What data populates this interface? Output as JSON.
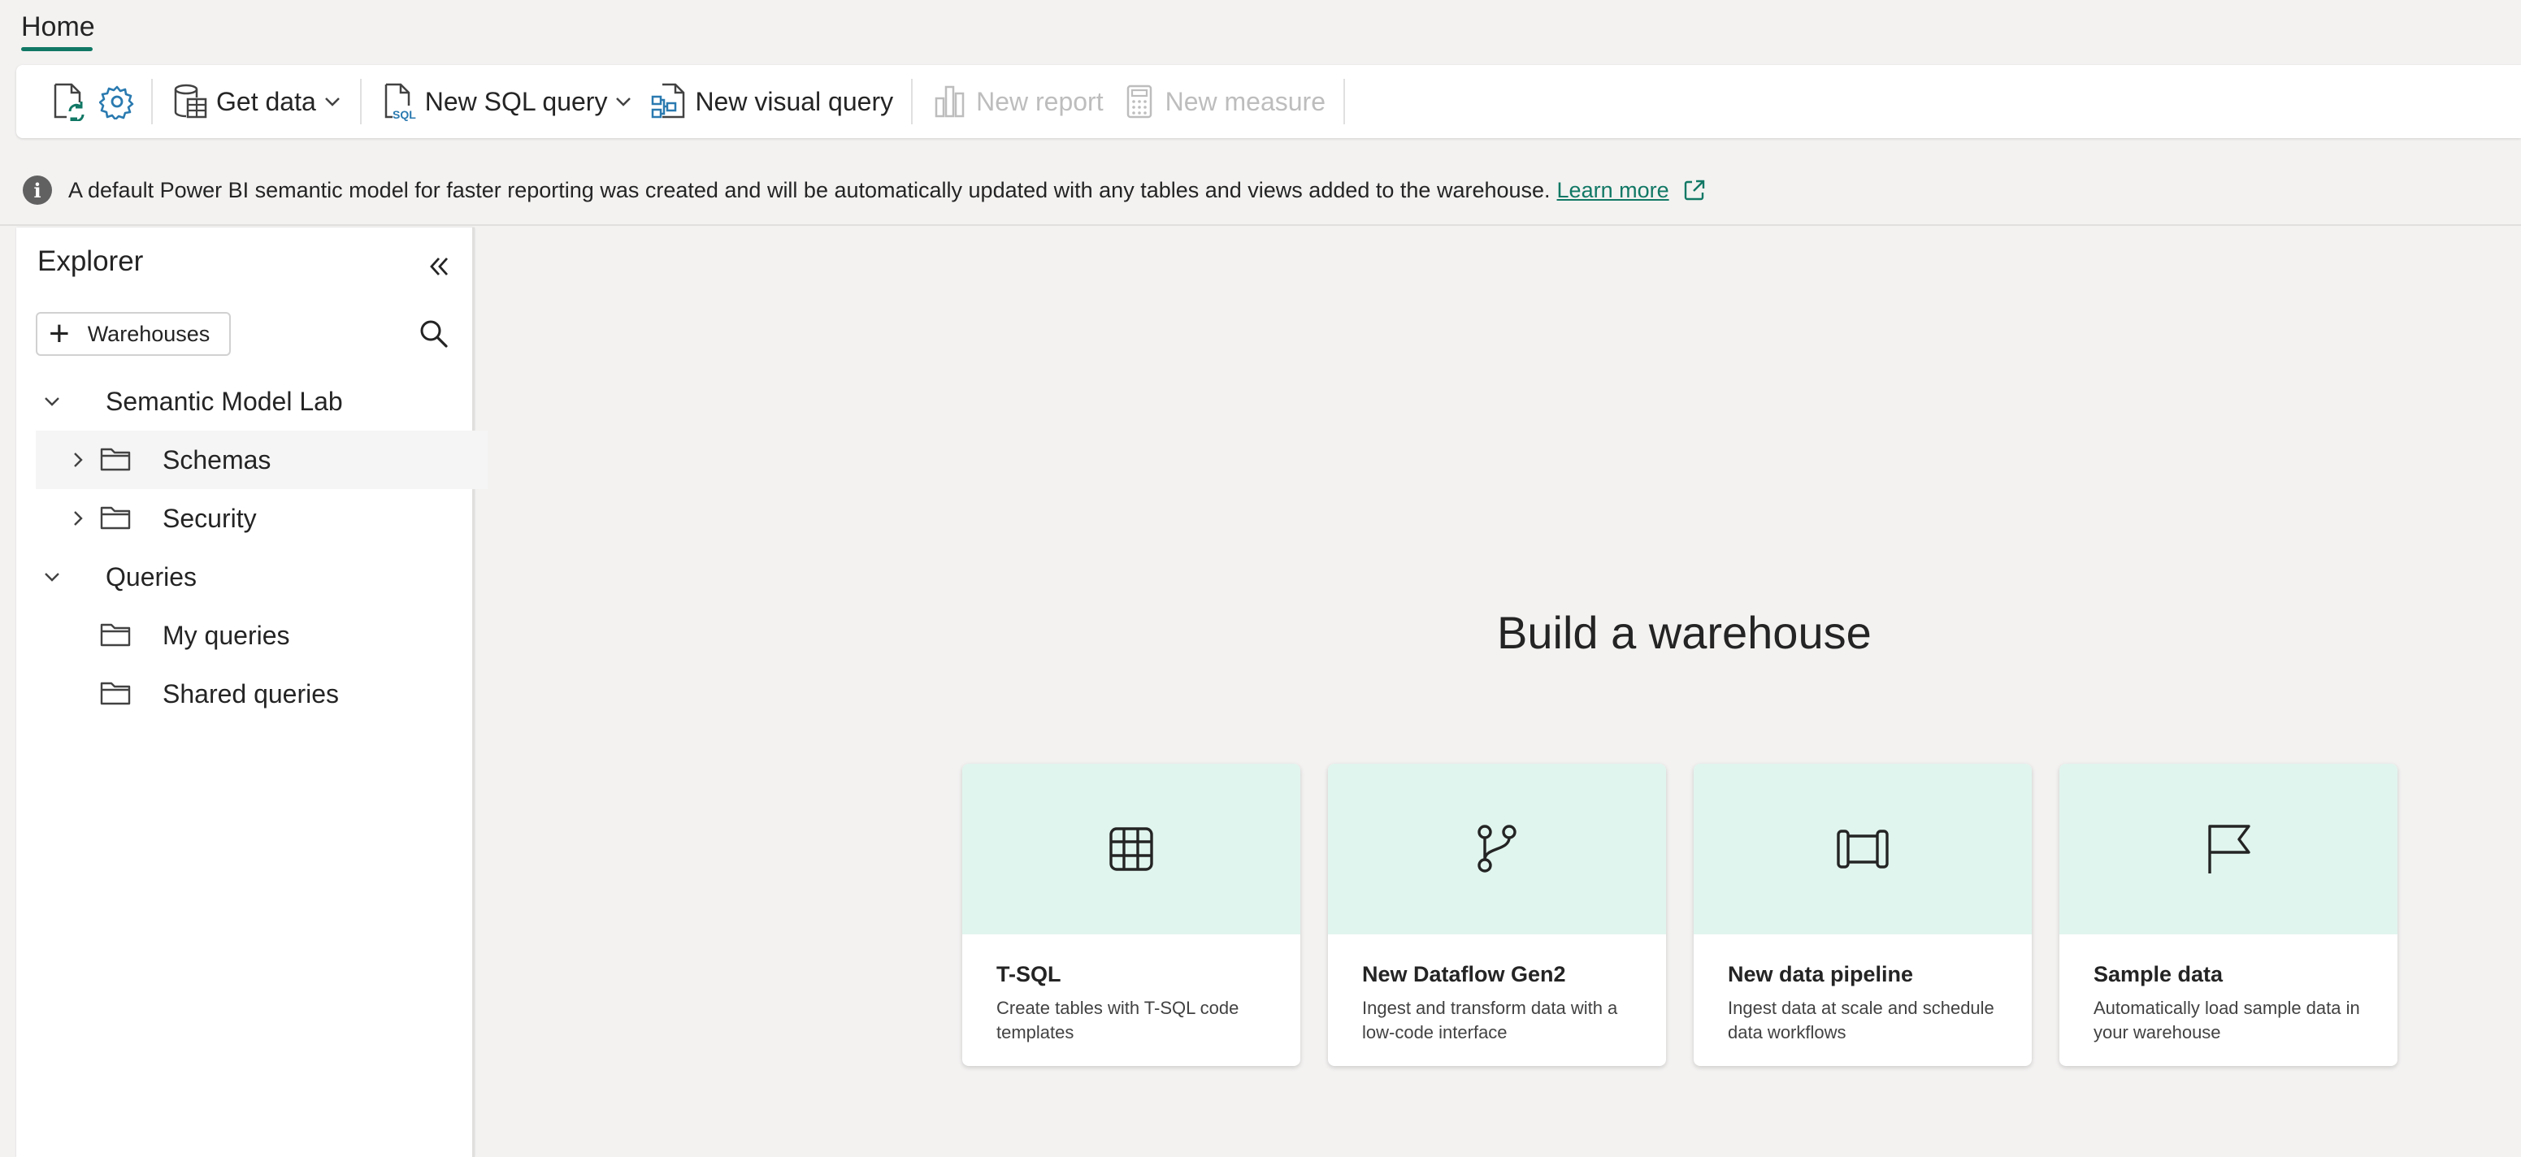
{
  "tabs": {
    "home": "Home"
  },
  "ribbon": {
    "get_data": "Get data",
    "new_sql_query": "New SQL query",
    "new_visual_query": "New visual query",
    "new_report": "New report",
    "new_measure": "New measure"
  },
  "info": {
    "message": "A default Power BI semantic model for faster reporting was created and will be automatically updated with any tables and views added to the warehouse.",
    "link": "Learn more"
  },
  "explorer": {
    "title": "Explorer",
    "add_button": "Warehouses",
    "tree": [
      {
        "label": "Semantic Model Lab"
      },
      {
        "label": "Schemas"
      },
      {
        "label": "Security"
      },
      {
        "label": "Queries"
      },
      {
        "label": "My queries"
      },
      {
        "label": "Shared queries"
      }
    ]
  },
  "main": {
    "title": "Build a warehouse",
    "cards": [
      {
        "title": "T-SQL",
        "desc": "Create tables with T-SQL code templates",
        "icon": "table-grid-icon"
      },
      {
        "title": "New Dataflow Gen2",
        "desc": "Ingest and transform data with a low-code interface",
        "icon": "dataflow-icon"
      },
      {
        "title": "New data pipeline",
        "desc": "Ingest data at scale and schedule data workflows",
        "icon": "pipeline-icon"
      },
      {
        "title": "Sample data",
        "desc": "Automatically load sample data in your warehouse",
        "icon": "flag-icon"
      }
    ]
  },
  "colors": {
    "accent": "#117865",
    "card_top": "#e0f5ee"
  }
}
